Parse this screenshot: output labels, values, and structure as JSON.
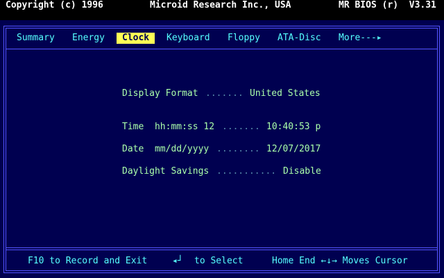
{
  "header": {
    "copyright": "Copyright (c) 1996",
    "company": "Microid Research Inc., USA",
    "bios_version": "MR BIOS (r)  V3.31"
  },
  "menu": {
    "items": [
      {
        "label": "Summary"
      },
      {
        "label": "Energy"
      },
      {
        "label": "Clock",
        "active": true
      },
      {
        "label": "Keyboard"
      },
      {
        "label": "Floppy"
      },
      {
        "label": "ATA-Disc"
      },
      {
        "label": "More---▸"
      }
    ]
  },
  "settings": {
    "display_format": {
      "label": "Display Format",
      "dots": ".......",
      "value": "United States"
    },
    "time": {
      "label": "Time  hh:mm:ss 12",
      "dots": ".......",
      "value": "10:40:53 p"
    },
    "date": {
      "label": "Date  mm/dd/yyyy",
      "dots": "........",
      "value": "12/07/2017"
    },
    "daylight_savings": {
      "label": "Daylight Savings",
      "dots": "...........",
      "value": "Disable"
    }
  },
  "footer": {
    "record_exit": "F10 to Record and Exit",
    "enter_symbol": "◂┘",
    "select": "to Select",
    "move_cursor": "Home End ←↓→ Moves Cursor"
  },
  "colors": {
    "background": "#000050",
    "frame": "#5555FF",
    "menu_text": "#55FFFF",
    "menu_active_bg": "#FFFF55",
    "setting_text": "#AAFFAA",
    "dots": "#5588AA"
  }
}
